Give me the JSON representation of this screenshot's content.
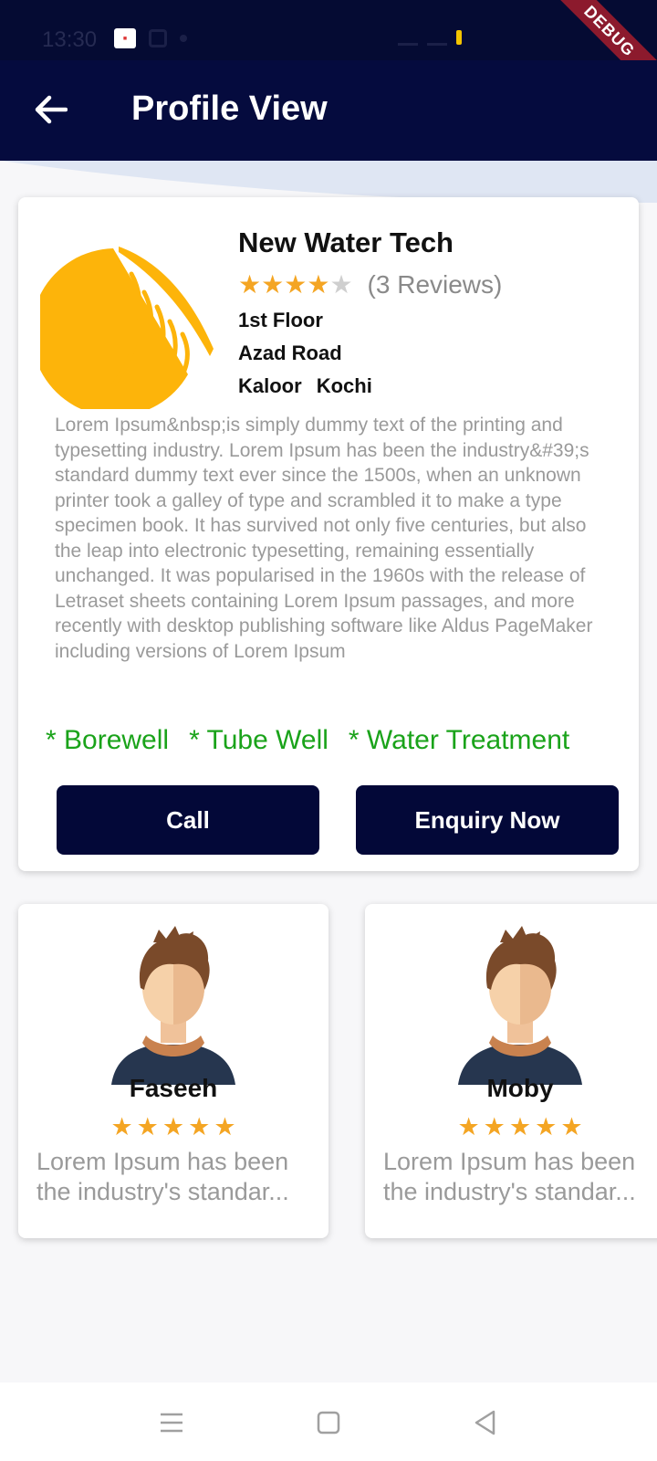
{
  "status_bar": {
    "time": "13:30",
    "debug_label": "DEBUG"
  },
  "app_bar": {
    "title": "Profile View"
  },
  "business": {
    "name": "New Water Tech",
    "rating": 4,
    "max_rating": 5,
    "reviews_text": "(3 Reviews)",
    "address_line1": "1st Floor",
    "address_line2": "Azad Road",
    "address_area": "Kaloor",
    "address_city": "Kochi",
    "description": "Lorem Ipsum&nbsp;is simply dummy text of the printing and typesetting industry. Lorem Ipsum has been the industry&#39;s standard dummy text ever since the 1500s, when an unknown printer took a galley of type and scrambled it to make a type specimen book. It has survived not only five centuries, but also the leap into electronic typesetting, remaining essentially unchanged. It was popularised in the 1960s with the release of Letraset sheets containing Lorem Ipsum passages, and more recently with desktop publishing software like Aldus PageMaker including versions of Lorem Ipsum",
    "services": [
      "* Borewell",
      "* Tube Well",
      "* Water Treatment"
    ],
    "buttons": {
      "call": "Call",
      "enquiry": "Enquiry Now"
    }
  },
  "reviews": [
    {
      "name": "Faseeh",
      "rating": 5,
      "text": "Lorem Ipsum has been the industry's standar..."
    },
    {
      "name": "Moby",
      "rating": 5,
      "text": "Lorem Ipsum has been the industry's standar..."
    }
  ],
  "colors": {
    "app_bar": "#050b3e",
    "button": "#030838",
    "star": "#f4a523",
    "service_text": "#1aa31a",
    "logo": "#fdb40a"
  },
  "icons": {
    "back": "arrow-left-icon",
    "nav_menu": "menu-lines-icon",
    "nav_home": "square-icon",
    "nav_back": "triangle-back-icon"
  }
}
